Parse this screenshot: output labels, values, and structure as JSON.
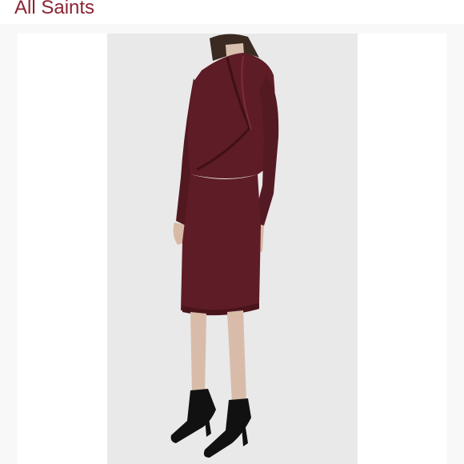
{
  "listing": {
    "brand": "All Saints",
    "brand_color": "#8a2432"
  },
  "photo": {
    "subject": "product-photo",
    "dress_color": "#5e1c26",
    "boot_color": "#111111",
    "background_color": "#e9e9ea"
  }
}
